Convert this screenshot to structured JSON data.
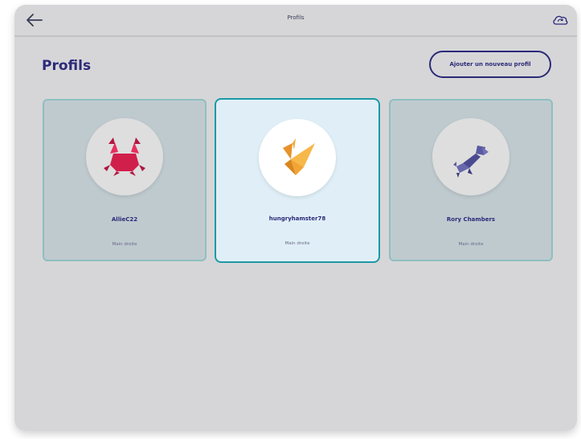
{
  "header": {
    "title": "Profils",
    "back_icon": "arrow-left-icon",
    "sync_icon": "cloud-sync-icon"
  },
  "main": {
    "heading": "Profils",
    "add_button_label": "Ajouter un nouveau profil"
  },
  "profiles": [
    {
      "name": "AllieC22",
      "hand": "Main droite",
      "avatar_icon": "crab-origami-icon",
      "avatar_color": "#d11f4c",
      "selected": false
    },
    {
      "name": "hungryhamster78",
      "hand": "Main droite",
      "avatar_icon": "bird-origami-icon",
      "avatar_color": "#f2a534",
      "selected": true
    },
    {
      "name": "Rory Chambers",
      "hand": "Main droite",
      "avatar_icon": "dog-origami-icon",
      "avatar_color": "#5a5aa0",
      "selected": false
    }
  ],
  "colors": {
    "accent": "#2c2a78",
    "selected_border": "#1b9aa6",
    "background": "#d6d6d8"
  }
}
